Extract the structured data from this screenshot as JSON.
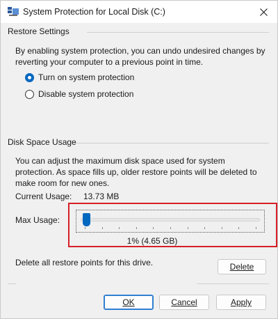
{
  "window": {
    "title": "System Protection for Local Disk (C:)"
  },
  "restore_settings": {
    "header": "Restore Settings",
    "description": "By enabling system protection, you can undo undesired changes by reverting your computer to a previous point in time.",
    "options": [
      {
        "label": "Turn on system protection",
        "checked": true
      },
      {
        "label": "Disable system protection",
        "checked": false
      }
    ]
  },
  "disk_space": {
    "header": "Disk Space Usage",
    "description": "You can adjust the maximum disk space used for system protection. As space fills up, older restore points will be deleted to make room for new ones.",
    "current_usage_label": "Current Usage:",
    "current_usage_value": "13.73 MB",
    "max_usage_label": "Max Usage:",
    "max_usage_percent": 1,
    "max_usage_display": "1% (4.65 GB)",
    "delete_text": "Delete all restore points for this drive.",
    "delete_button": "Delete"
  },
  "footer": {
    "ok": "OK",
    "cancel": "Cancel",
    "apply": "Apply"
  },
  "colors": {
    "accent": "#0067c0",
    "highlight_border": "#d61f26"
  }
}
